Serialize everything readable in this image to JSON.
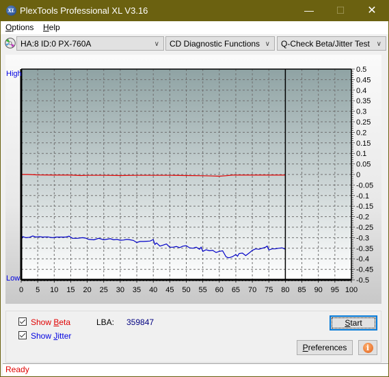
{
  "window": {
    "title": "PlexTools Professional XL V3.16",
    "app_icon_text": "XL",
    "controls": {
      "minimize": "—",
      "maximize": "☐",
      "close": "✕"
    }
  },
  "menu": [
    {
      "label_u": "O",
      "label_rest": "ptions"
    },
    {
      "label_u": "H",
      "label_rest": "elp"
    }
  ],
  "toolbar": {
    "drive_icon": "cd-drive-icon",
    "drive_select": "HA:8 ID:0  PX-760A",
    "function_select": "CD Diagnostic Functions",
    "test_select": "Q-Check Beta/Jitter Test",
    "chevron": "∨"
  },
  "chart_data": {
    "type": "line",
    "title": "",
    "xlabel": "",
    "ylabel": "",
    "left_axis_labels": {
      "top": "High",
      "bottom": "Low"
    },
    "xlim": [
      0,
      100
    ],
    "ylim": [
      -0.5,
      0.5
    ],
    "x_ticks": [
      0,
      5,
      10,
      15,
      20,
      25,
      30,
      35,
      40,
      45,
      50,
      55,
      60,
      65,
      70,
      75,
      80,
      85,
      90,
      95,
      100
    ],
    "y_ticks": [
      0.5,
      0.45,
      0.4,
      0.35,
      0.3,
      0.25,
      0.2,
      0.15,
      0.1,
      0.05,
      0,
      -0.05,
      -0.1,
      -0.15,
      -0.2,
      -0.25,
      -0.3,
      -0.35,
      -0.4,
      -0.45,
      -0.5
    ],
    "y_tick_labels": [
      "0.5",
      "0.45",
      "0.4",
      "0.35",
      "0.3",
      "0.25",
      "0.2",
      "0.15",
      "0.1",
      "0.05",
      "0",
      "-0.05",
      "-0.1",
      "-0.15",
      "-0.2",
      "-0.25",
      "-0.3",
      "-0.35",
      "-0.4",
      "-0.45",
      "-0.5"
    ],
    "grid": true,
    "end_marker_x": 80,
    "colors": {
      "beta": "#e00000",
      "jitter": "#0000c8",
      "bg_top": "#8fa3a4",
      "bg_bottom": "#ffffff"
    },
    "series": [
      {
        "name": "Beta",
        "x": [
          0,
          2,
          5,
          10,
          15,
          18,
          20,
          25,
          30,
          35,
          40,
          45,
          50,
          55,
          58,
          60,
          62,
          64,
          66,
          70,
          75,
          80
        ],
        "values": [
          0.0,
          0.0,
          -0.002,
          -0.003,
          -0.003,
          -0.005,
          -0.004,
          -0.004,
          -0.005,
          -0.004,
          -0.004,
          -0.004,
          -0.005,
          -0.006,
          -0.007,
          -0.008,
          -0.006,
          -0.003,
          -0.003,
          -0.003,
          -0.003,
          -0.003
        ]
      },
      {
        "name": "Jitter",
        "x": [
          0,
          0.5,
          1.5,
          2.5,
          3.5,
          4.5,
          5.5,
          6.5,
          8,
          9.5,
          10.5,
          12,
          13.5,
          14.5,
          15.5,
          17,
          18.5,
          19.5,
          20.5,
          22,
          23.5,
          25,
          26,
          27,
          28,
          29,
          30,
          31,
          32,
          33,
          34,
          35,
          36,
          37,
          38,
          39,
          40,
          40.5,
          41,
          42,
          43,
          44,
          45,
          46,
          47,
          48,
          49,
          50,
          51,
          52,
          53,
          54,
          54.5,
          55,
          56,
          57,
          58,
          59,
          60,
          61,
          62,
          62.5,
          63,
          64,
          65,
          65.5,
          66,
          67,
          68,
          69,
          70,
          71,
          72,
          73,
          74,
          74.5,
          75,
          76,
          77,
          78,
          79,
          80
        ],
        "values": [
          -0.31,
          -0.295,
          -0.3,
          -0.298,
          -0.292,
          -0.297,
          -0.295,
          -0.297,
          -0.296,
          -0.3,
          -0.297,
          -0.297,
          -0.297,
          -0.293,
          -0.303,
          -0.303,
          -0.3,
          -0.302,
          -0.308,
          -0.31,
          -0.303,
          -0.31,
          -0.307,
          -0.305,
          -0.31,
          -0.308,
          -0.312,
          -0.311,
          -0.308,
          -0.31,
          -0.313,
          -0.323,
          -0.318,
          -0.318,
          -0.317,
          -0.316,
          -0.309,
          -0.332,
          -0.325,
          -0.34,
          -0.335,
          -0.33,
          -0.345,
          -0.345,
          -0.342,
          -0.347,
          -0.34,
          -0.338,
          -0.348,
          -0.35,
          -0.345,
          -0.355,
          -0.345,
          -0.365,
          -0.357,
          -0.362,
          -0.36,
          -0.37,
          -0.365,
          -0.362,
          -0.39,
          -0.394,
          -0.395,
          -0.39,
          -0.38,
          -0.388,
          -0.375,
          -0.373,
          -0.385,
          -0.373,
          -0.36,
          -0.353,
          -0.355,
          -0.35,
          -0.345,
          -0.34,
          -0.358,
          -0.353,
          -0.353,
          -0.35,
          -0.348,
          -0.355
        ]
      }
    ]
  },
  "controls": {
    "show_beta": {
      "label_pre": "Show ",
      "label_u": "B",
      "label_rest": "eta",
      "checked": true
    },
    "show_jitter": {
      "label_pre": "Show ",
      "label_u": "J",
      "label_rest": "itter",
      "checked": true
    },
    "lba_label": "LBA:",
    "lba_value": "359847",
    "start_u": "S",
    "start_rest": "tart",
    "preferences_u": "P",
    "preferences_rest": "references",
    "info_icon": "i"
  },
  "status": {
    "text": "Ready"
  }
}
